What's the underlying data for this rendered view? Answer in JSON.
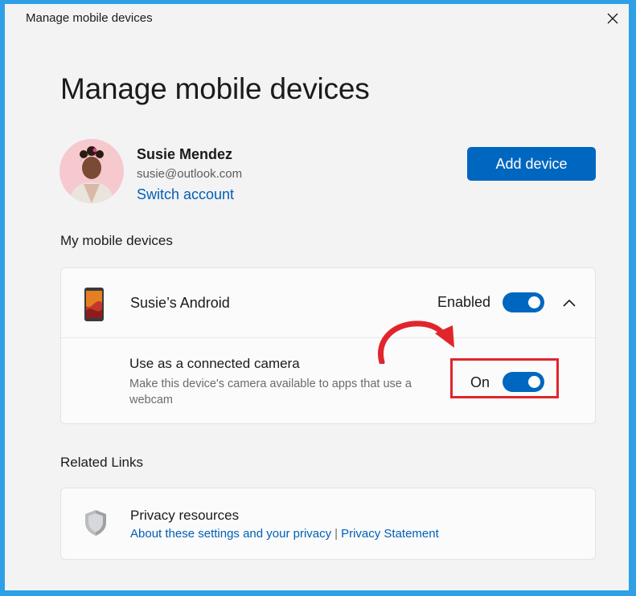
{
  "window": {
    "title": "Manage mobile devices"
  },
  "page": {
    "title": "Manage mobile devices"
  },
  "account": {
    "name": "Susie Mendez",
    "email": "susie@outlook.com",
    "switch_label": "Switch account",
    "add_device_label": "Add device"
  },
  "devices_section": {
    "heading": "My mobile devices",
    "device": {
      "name": "Susie’s Android",
      "status_label": "Enabled",
      "enabled": true,
      "camera_title": "Use as a connected camera",
      "camera_description": "Make this device's camera available to apps that use a webcam",
      "camera_state_label": "On",
      "camera_on": true
    }
  },
  "links_section": {
    "heading": "Related Links",
    "privacy_title": "Privacy resources",
    "privacy_link_1": "About these settings and your privacy",
    "separator": "|",
    "privacy_link_2": "Privacy Statement"
  },
  "colors": {
    "accent": "#0067c0",
    "link": "#005fb8",
    "highlight": "#e0262b",
    "frame": "#2f9fe6"
  },
  "icons": [
    "close-icon",
    "phone-icon",
    "chevron-up-icon",
    "shield-icon",
    "arrow-annotation"
  ]
}
